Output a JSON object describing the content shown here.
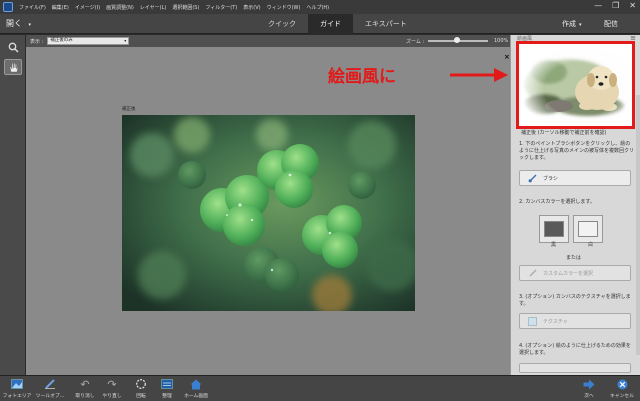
{
  "menubar": {
    "items": [
      "ファイル(F)",
      "編集(E)",
      "イメージ(I)",
      "画質調整(N)",
      "レイヤー(L)",
      "選択範囲(S)",
      "フィルター(T)",
      "表示(V)",
      "ウィンドウ(W)",
      "ヘルプ(H)"
    ],
    "window_controls": [
      "—",
      "❐",
      "✕"
    ]
  },
  "modebar": {
    "open_label": "開く",
    "tabs": [
      "クイック",
      "ガイド",
      "エキスパート"
    ],
    "active_tab": "ガイド",
    "create_label": "作成",
    "share_label": "配信"
  },
  "options": {
    "view_label": "表示 :",
    "view_value": "補正後のみ",
    "zoom_label": "ズーム :",
    "zoom_value": "100%"
  },
  "canvas": {
    "photo_label": "補正後",
    "close": "×"
  },
  "panel": {
    "header": "絵画風",
    "title": "補正後 (カーソル移動で補正前を確認)",
    "step1": "1. 下のペイントブラシボタンをクリックし、絵のように仕上げる写真のメインの被写体を複数回クリックします。",
    "brush_label": "ブラシ",
    "step2": "2. カンバスカラーを選択します。",
    "black_label": "黒",
    "white_label": "白",
    "or_label": "または",
    "custom_color_label": "カスタムカラーを選択",
    "step3": "3. (オプション) カンバスのテクスチャを選択します。",
    "texture_label": "テクスチャ",
    "step4": "4. (オプション) 絵のように仕上げるための効果を選択します。"
  },
  "annotation": {
    "text": "絵画風に",
    "color": "#e21a1a"
  },
  "bottombar": {
    "items": [
      "フォトエリア",
      "ツールオプ...",
      "取り消し",
      "やり直し",
      "回転",
      "整理",
      "ホーム画面"
    ],
    "next_label": "次へ",
    "cancel_label": "キャンセル"
  }
}
